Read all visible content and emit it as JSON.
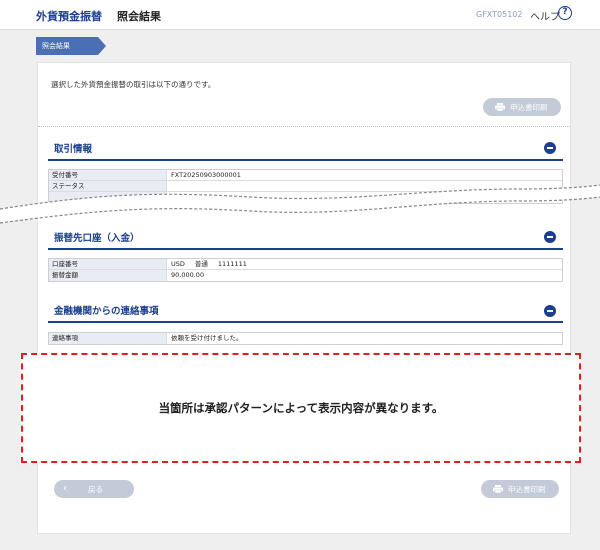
{
  "header": {
    "title": "外貨預金振替",
    "subtitle": "照会結果",
    "screen_code": "GFXT05102",
    "help_label": "ヘルプ",
    "help_icon": "?"
  },
  "breadcrumb": {
    "label": "照会結果"
  },
  "intro_text": "選択した外貨預金振替の取引は以下の通りです。",
  "print_button": {
    "label": "申込書印刷"
  },
  "sections": {
    "transaction": {
      "title": "取引情報",
      "rows": [
        {
          "label": "受付番号",
          "value": "FXT20250903000001"
        },
        {
          "label": "ステータス",
          "value": ""
        }
      ]
    },
    "destination": {
      "title": "振替先口座（入金）",
      "rows": [
        {
          "label": "口座番号",
          "currency": "USD",
          "type": "普通",
          "number": "1111111"
        },
        {
          "label": "振替金額",
          "value": "90,000.00"
        }
      ]
    },
    "message": {
      "title": "金融機関からの連絡事項",
      "rows": [
        {
          "label": "連絡事項",
          "value": "依頼を受け付けました。"
        }
      ]
    }
  },
  "notice_text": "当箇所は承認パターンによって表示内容が異なります。",
  "back_button": {
    "label": "戻る"
  },
  "colors": {
    "accent": "#1a3f8c",
    "button": "#c3cbd9",
    "notice_border": "#e02020"
  }
}
